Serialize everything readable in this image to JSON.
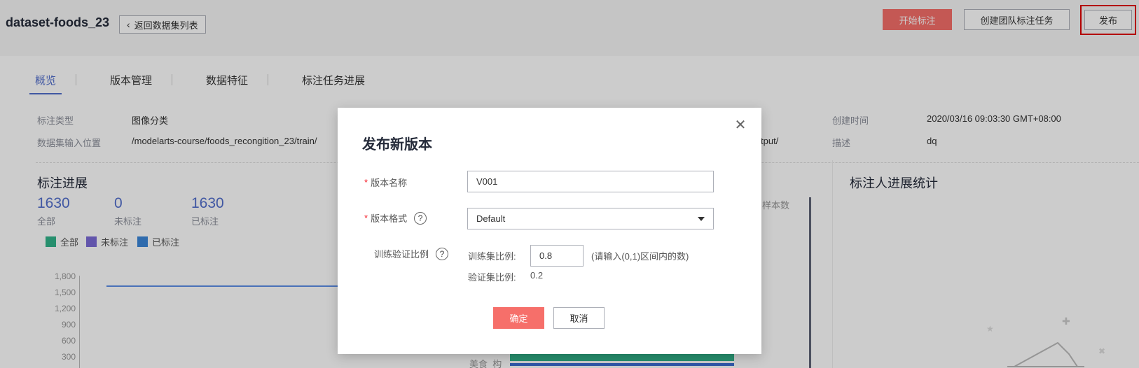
{
  "header": {
    "dataset_title": "dataset-foods_23",
    "back_label": "返回数据集列表",
    "start_label": "开始标注",
    "team_task_label": "创建团队标注任务",
    "publish_label": "发布"
  },
  "tabs": [
    {
      "label": "概览"
    },
    {
      "label": "版本管理"
    },
    {
      "label": "数据特征"
    },
    {
      "label": "标注任务进展"
    }
  ],
  "info": {
    "type_label": "标注类型",
    "type_value": "图像分类",
    "input_label": "数据集输入位置",
    "input_value": "/modelarts-course/foods_recongition_23/train/",
    "output_partial": "tput/",
    "created_label": "创建时间",
    "created_value": "2020/03/16 09:03:30 GMT+08:00",
    "desc_label": "描述",
    "desc_value": "dq"
  },
  "progress": {
    "title": "标注进展",
    "total_num": "1630",
    "total_label": "全部",
    "unlabeled_num": "0",
    "unlabeled_label": "未标注",
    "labeled_num": "1630",
    "labeled_label": "已标注",
    "legend": [
      {
        "label": "全部",
        "color": "#31b38a"
      },
      {
        "label": "未标注",
        "color": "#7b6bd6"
      },
      {
        "label": "已标注",
        "color": "#3b86d9"
      }
    ],
    "y_ticks": [
      "1,800",
      "1,500",
      "1,200",
      "900",
      "600",
      "300"
    ]
  },
  "bar_panel": {
    "sample_label": "样本数",
    "category_label": "美食_构_"
  },
  "annotator": {
    "title": "标注人进展统计"
  },
  "dialog": {
    "title": "发布新版本",
    "version_name_label": "版本名称",
    "version_name_value": "V001",
    "version_format_label": "版本格式",
    "version_format_value": "Default",
    "split_label": "训练验证比例",
    "train_ratio_label": "训练集比例:",
    "train_ratio_value": "0.8",
    "train_ratio_hint": "(请输入(0,1)区间内的数)",
    "val_ratio_label": "验证集比例:",
    "val_ratio_value": "0.2",
    "confirm_label": "确定",
    "cancel_label": "取消"
  }
}
